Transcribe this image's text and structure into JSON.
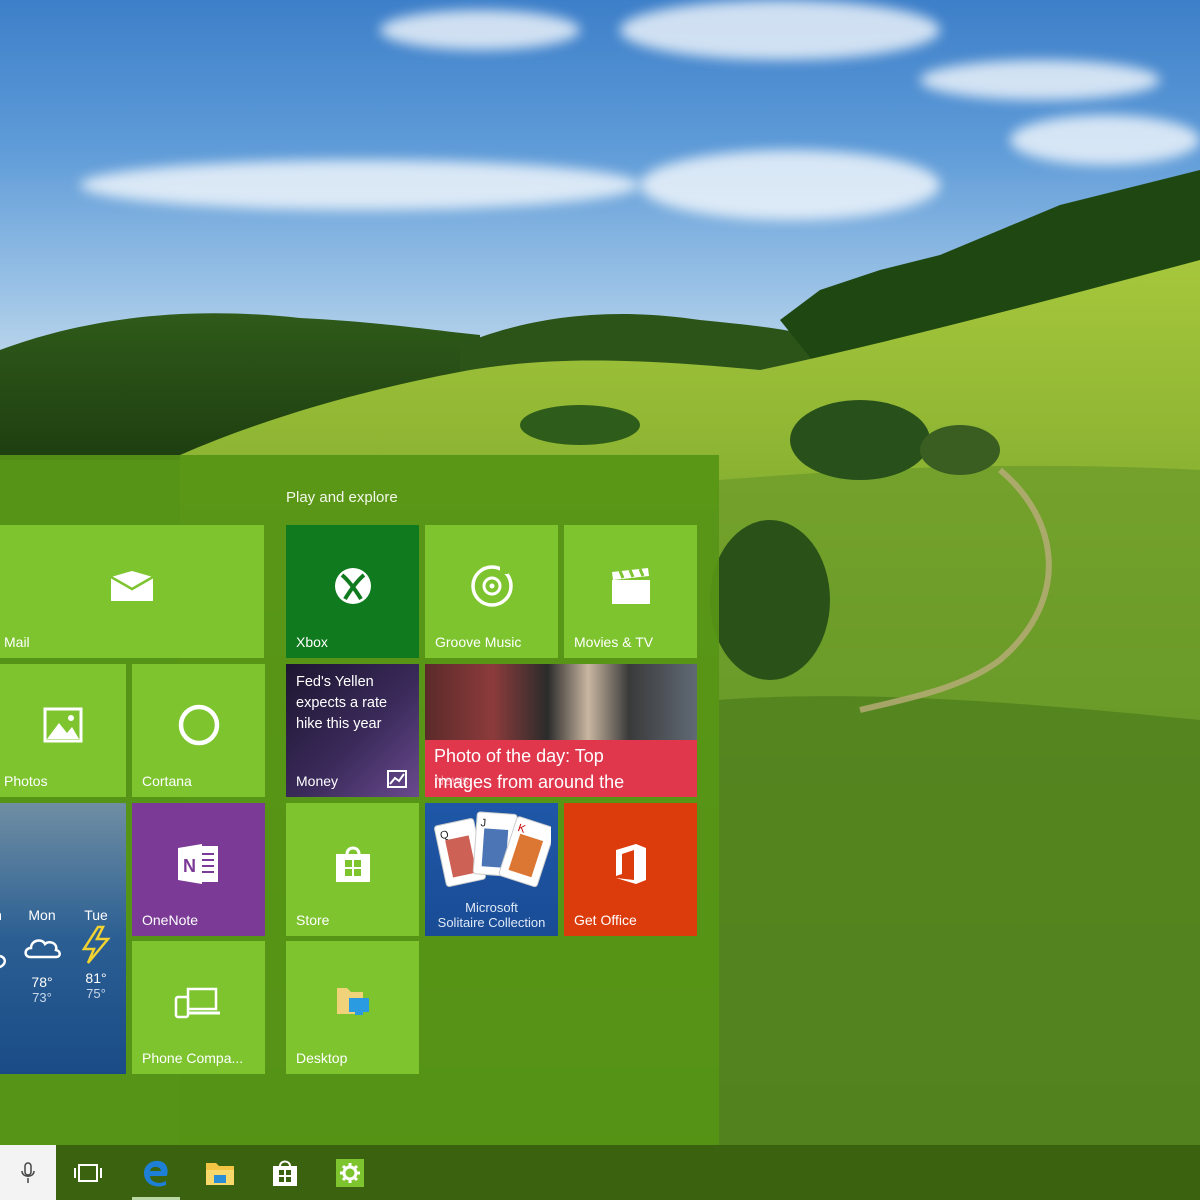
{
  "start_menu": {
    "group_title": "Play and explore",
    "tiles": {
      "mail": "Mail",
      "xbox": "Xbox",
      "groove": "Groove Music",
      "movies": "Movies & TV",
      "photos": "Photos",
      "cortana": "Cortana",
      "money_headline": "Fed's Yellen expects a rate hike this year",
      "money": "Money",
      "news_headline_line1": "Photo of the day: Top",
      "news_headline_line2": "images from around the",
      "news": "News",
      "onenote": "OneNote",
      "store": "Store",
      "solitaire_line1": "Microsoft",
      "solitaire_line2": "Solitaire Collection",
      "get_office": "Get Office",
      "phone": "Phone Compa...",
      "desktop": "Desktop"
    },
    "weather": {
      "days": [
        {
          "day": "Mon",
          "hi": "78°",
          "lo": "73°",
          "icon": "cloud-icon"
        },
        {
          "day": "Tue",
          "hi": "81°",
          "lo": "75°",
          "icon": "lightning-icon"
        }
      ]
    }
  },
  "taskbar": {
    "items": [
      "microphone-icon",
      "task-view-icon",
      "edge-icon",
      "file-explorer-icon",
      "store-icon",
      "settings-icon"
    ]
  },
  "colors": {
    "menu": "#569416",
    "lime_tile": "#7dc42f",
    "xbox_tile": "#0f7a1e",
    "onenote_tile": "#7b3a96",
    "office_tile": "#dc3b0c",
    "news_caption": "#e0374d"
  }
}
